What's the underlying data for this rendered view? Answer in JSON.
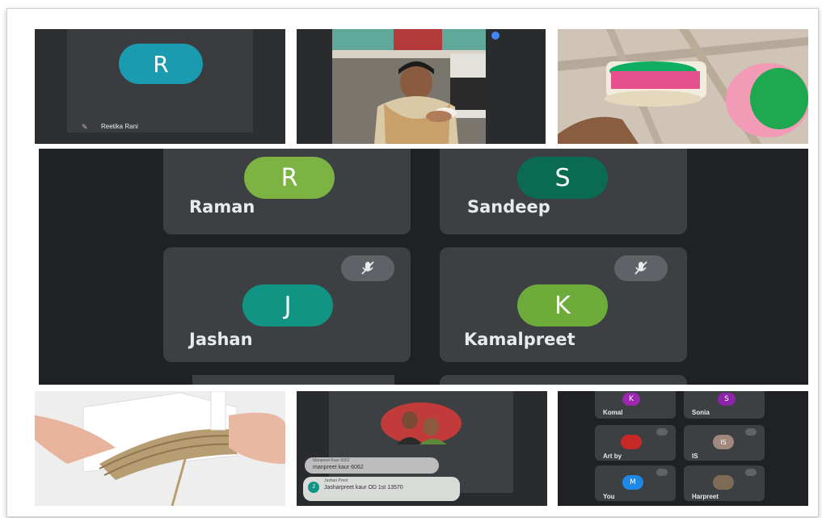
{
  "tile1": {
    "avatar_letter": "R",
    "avatar_color": "#1a9bb0",
    "name": "Reetika Rani"
  },
  "main_grid": {
    "participants": [
      {
        "letter": "R",
        "name": "Raman",
        "color": "#7cb342"
      },
      {
        "letter": "S",
        "name": "Sandeep",
        "color": "#0b6b52"
      },
      {
        "letter": "J",
        "name": "Jashan",
        "color": "#129484"
      },
      {
        "letter": "K",
        "name": "Kamalpreet",
        "color": "#6dab3b"
      }
    ]
  },
  "chat": {
    "messages": [
      {
        "sender": "Manpreet Kaur 6062",
        "text": "manpreet kaur 6062"
      },
      {
        "sender": "Jashan Preet",
        "avatar": "J",
        "text": "Jasharpreet kaur OD 1st 13570"
      }
    ]
  },
  "mini_grid": {
    "participants": [
      {
        "letter": "K",
        "name": "Komal",
        "color": "#9c27b0"
      },
      {
        "letter": "S",
        "name": "Sonia",
        "color": "#8e24aa"
      },
      {
        "letter": "",
        "name": "Art by",
        "color": "#c62828"
      },
      {
        "letter": "IS",
        "name": "IS",
        "color": "#a1887f"
      },
      {
        "letter": "M",
        "name": "You",
        "color": "#1e88e5"
      },
      {
        "letter": "",
        "name": "Harpreet",
        "color": "#7d6b56"
      }
    ]
  }
}
